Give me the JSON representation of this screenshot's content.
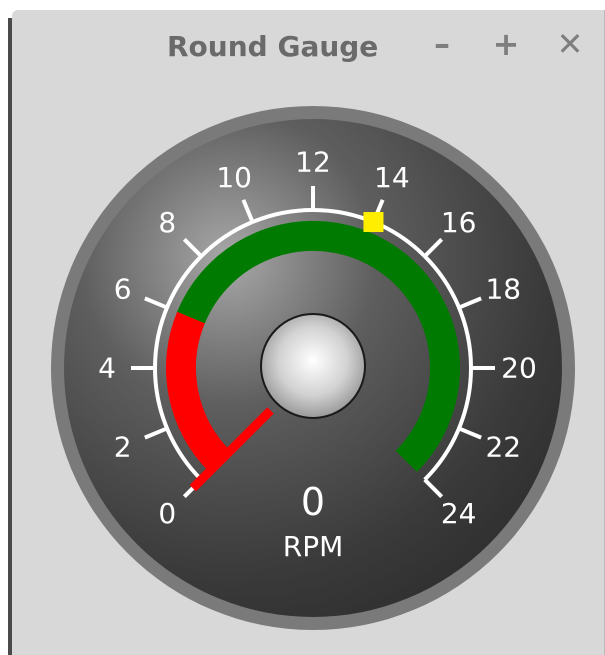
{
  "window": {
    "title": "Round Gauge",
    "minimize_label": "–",
    "maximize_label": "+",
    "close_label": "✕"
  },
  "gauge": {
    "type": "round-gauge",
    "value": 0,
    "value_text": "0",
    "unit": "RPM",
    "min": 0,
    "max": 24,
    "ticks": [
      "0",
      "2",
      "4",
      "6",
      "8",
      "10",
      "12",
      "14",
      "16",
      "18",
      "20",
      "22",
      "24"
    ],
    "zones": [
      {
        "from": 0,
        "to": 6,
        "color": "#ff0000"
      },
      {
        "from": 6,
        "to": 24,
        "color": "#007a00"
      }
    ],
    "marker_value": 14,
    "marker_color": "#ffee00",
    "needle_color": "#ff0000"
  }
}
